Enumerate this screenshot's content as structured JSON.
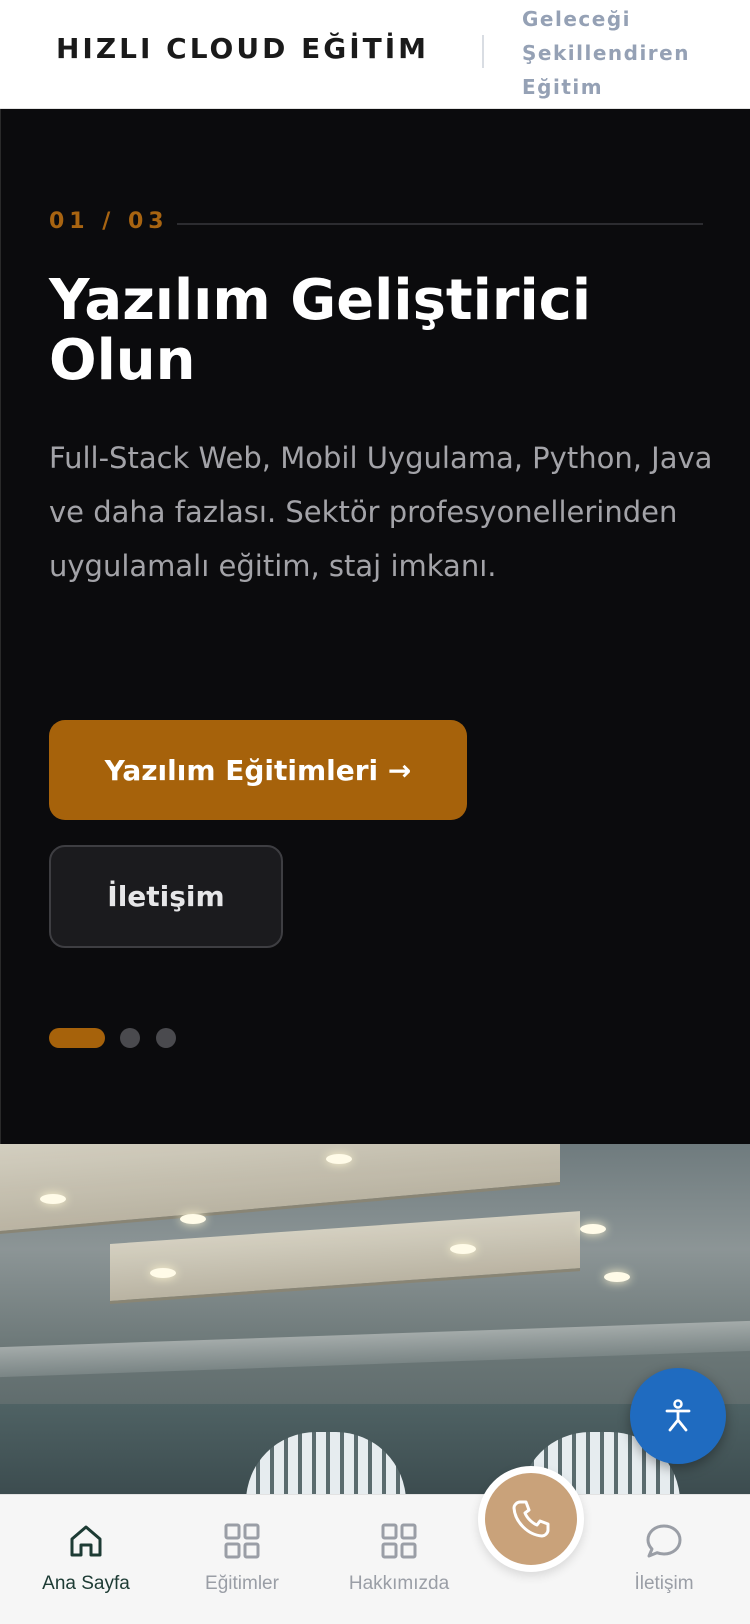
{
  "header": {
    "brand": "HIZLI CLOUD EĞİTİM",
    "tagline": "Geleceği Şekillendiren Eğitim"
  },
  "hero": {
    "slide_counter": "01 / 03",
    "title": "Yazılım Geliştirici Olun",
    "description": "Full-Stack Web, Mobil Uygulama, Python, Java ve daha fazlası. Sektör profesyonellerinden uygulamalı eğitim, staj imkanı.",
    "primary_button": "Yazılım Eğitimleri →",
    "secondary_button": "İletişim",
    "active_slide": 1,
    "total_slides": 3
  },
  "bottom_nav": {
    "items": [
      {
        "label": "Ana Sayfa",
        "icon": "home-icon",
        "active": true
      },
      {
        "label": "Eğitimler",
        "icon": "grid-icon",
        "active": false
      },
      {
        "label": "Hakkımızda",
        "icon": "grid-icon",
        "active": false
      },
      {
        "label": "İletişim",
        "icon": "chat-bubble-icon",
        "active": false
      }
    ],
    "call_icon": "phone-icon"
  },
  "floating": {
    "accessibility_icon": "accessibility-icon"
  },
  "colors": {
    "accent": "#a6620b",
    "hero_bg": "#0b0b0d",
    "call_button": "#c9a27a",
    "accessibility_button": "#1f6bc0",
    "nav_active": "#1d3b34"
  }
}
